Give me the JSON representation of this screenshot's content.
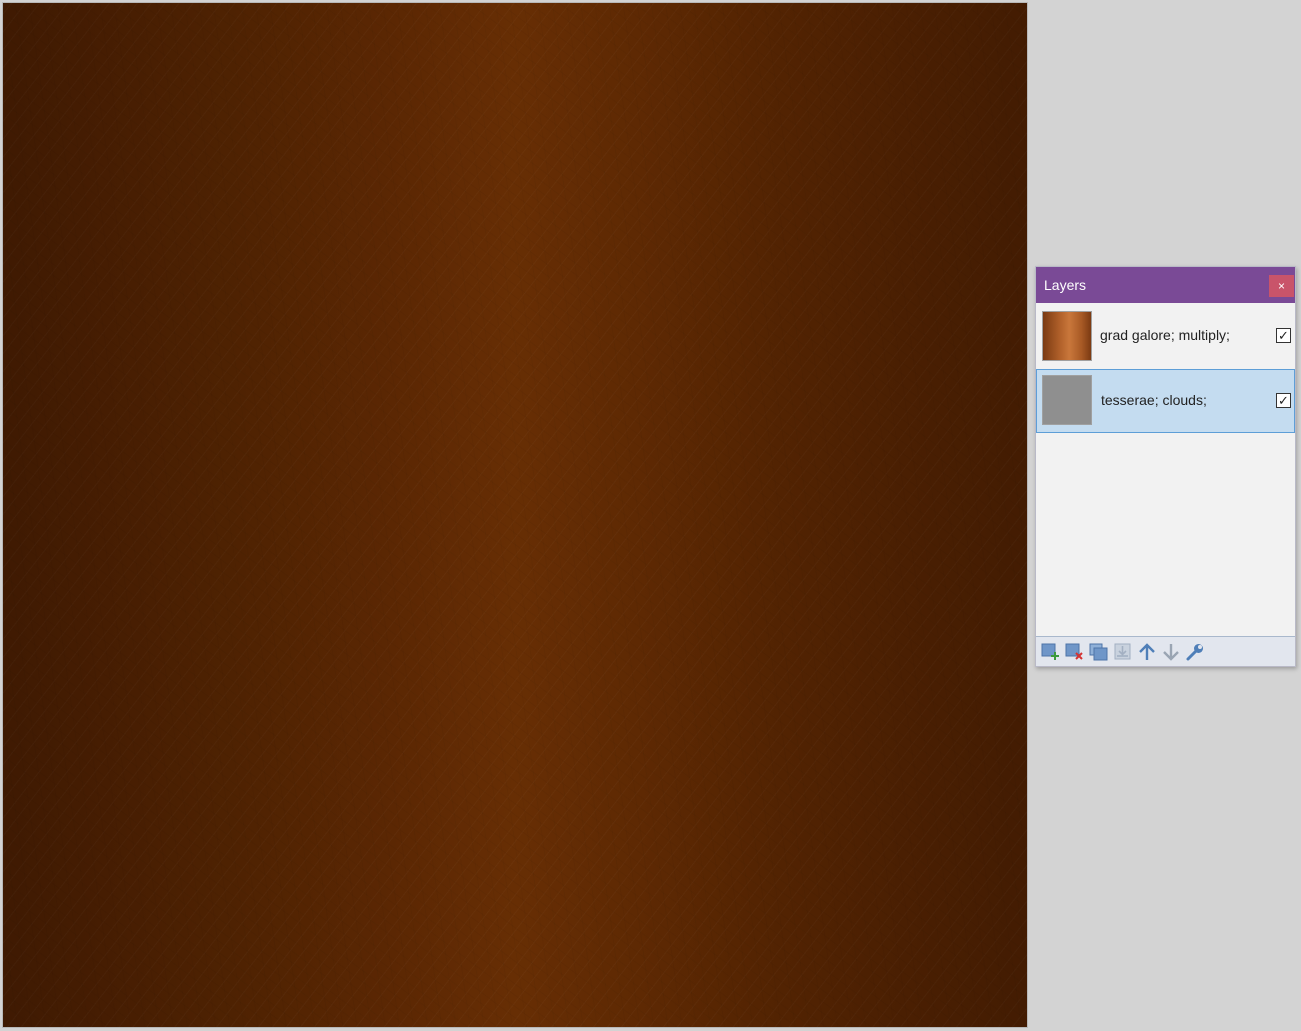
{
  "panel": {
    "title": "Layers",
    "close_label": "×",
    "accent_color": "#7a4a96"
  },
  "layers": [
    {
      "name": "grad galore; multiply;",
      "visible": true,
      "selected": false,
      "check": "✓"
    },
    {
      "name": "tesserae; clouds;",
      "visible": true,
      "selected": true,
      "check": "✓"
    }
  ],
  "toolbar": {
    "buttons": [
      "add-new-layer-icon",
      "delete-layer-icon",
      "duplicate-layer-icon",
      "merge-layer-down-icon",
      "move-layer-up-icon",
      "move-layer-down-icon",
      "layer-properties-icon"
    ]
  }
}
